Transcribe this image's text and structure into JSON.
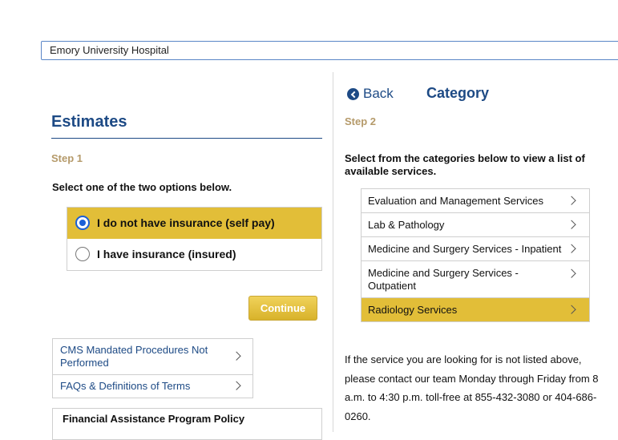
{
  "hospital_select": {
    "value": "Emory University Hospital"
  },
  "left": {
    "title": "Estimates",
    "step": "Step 1",
    "instruction": "Select one of the two options below.",
    "options": [
      {
        "label": "I do not have insurance (self pay)",
        "selected": true
      },
      {
        "label": "I have insurance (insured)",
        "selected": false
      }
    ],
    "continue_label": "Continue",
    "links": [
      "CMS Mandated Procedures Not Performed",
      "FAQs & Definitions of Terms"
    ],
    "policy_title": "Financial Assistance Program Policy"
  },
  "right": {
    "back_label": "Back",
    "title": "Category",
    "step": "Step 2",
    "instruction": "Select from the categories below to view a list of available services.",
    "categories": [
      {
        "label": "Evaluation and Management Services",
        "selected": false
      },
      {
        "label": "Lab & Pathology",
        "selected": false
      },
      {
        "label": "Medicine and Surgery Services - Inpatient",
        "selected": false
      },
      {
        "label": "Medicine and Surgery Services - Outpatient",
        "selected": false
      },
      {
        "label": "Radiology Services",
        "selected": true
      }
    ],
    "info": "If the service you are looking for is not listed above, please contact our team Monday through Friday from 8 a.m. to 4:30 p.m. toll-free at 855-432-3080 or 404-686-0260."
  },
  "colors": {
    "accent_gold": "#e2be38",
    "brand_blue": "#1d4a85",
    "step_tan": "#b59a6a"
  }
}
